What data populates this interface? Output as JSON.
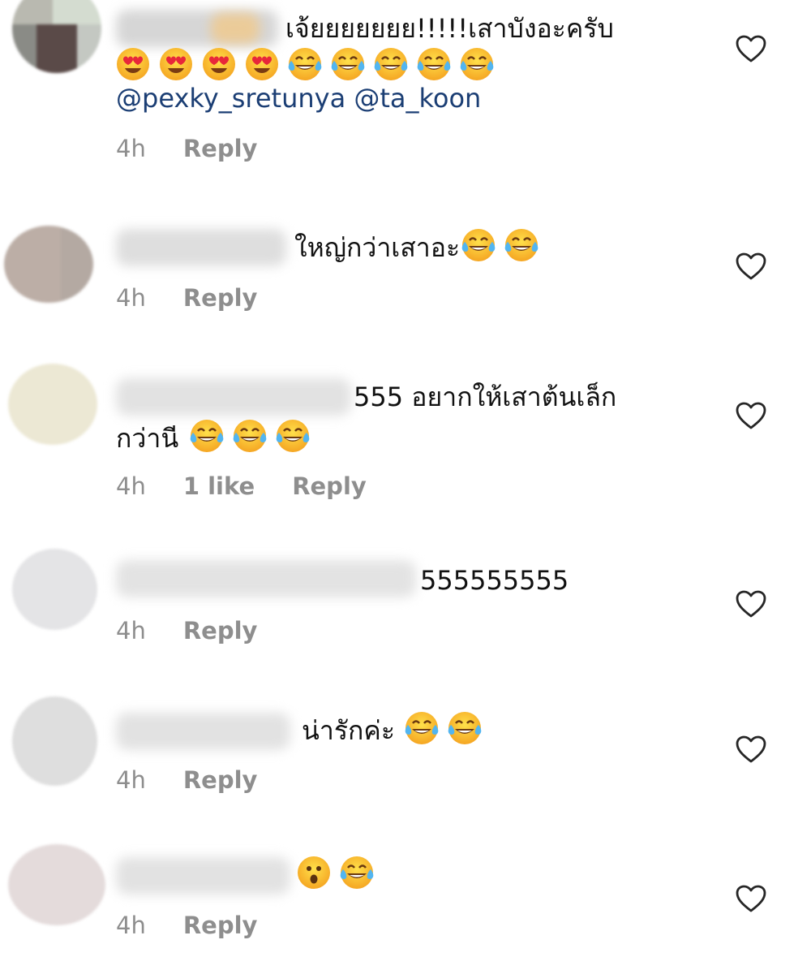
{
  "comments": [
    {
      "text": "เจ้ยยยยยยย!!!!!เสาบังอะครับ",
      "emojis": [
        "heart-eyes",
        "heart-eyes",
        "heart-eyes",
        "heart-eyes",
        "tears-of-joy",
        "tears-of-joy",
        "tears-of-joy",
        "tears-of-joy",
        "tears-of-joy"
      ],
      "mentions": [
        "@pexky_sretunya",
        "@ta_koon"
      ],
      "time": "4h",
      "reply": "Reply"
    },
    {
      "text": "ใหญ่กว่าเสาอะ",
      "emojis": [
        "tears-of-joy",
        "tears-of-joy"
      ],
      "time": "4h",
      "reply": "Reply"
    },
    {
      "text": "555 อยากให้เสาต้นเล็ก",
      "text2": "กว่านี",
      "emojis": [
        "tears-of-joy",
        "tears-of-joy",
        "tears-of-joy"
      ],
      "time": "4h",
      "likes": "1 like",
      "reply": "Reply"
    },
    {
      "text": "555555555",
      "time": "4h",
      "reply": "Reply"
    },
    {
      "text": "น่ารักค่ะ",
      "emojis": [
        "tears-of-joy",
        "tears-of-joy"
      ],
      "time": "4h",
      "reply": "Reply"
    },
    {
      "text": "",
      "emojis": [
        "astonished",
        "tears-of-joy"
      ],
      "time": "4h",
      "reply": "Reply"
    }
  ],
  "colors": {
    "meta": "#8e8e8e",
    "mention": "#1b3e74",
    "text": "#111111"
  }
}
